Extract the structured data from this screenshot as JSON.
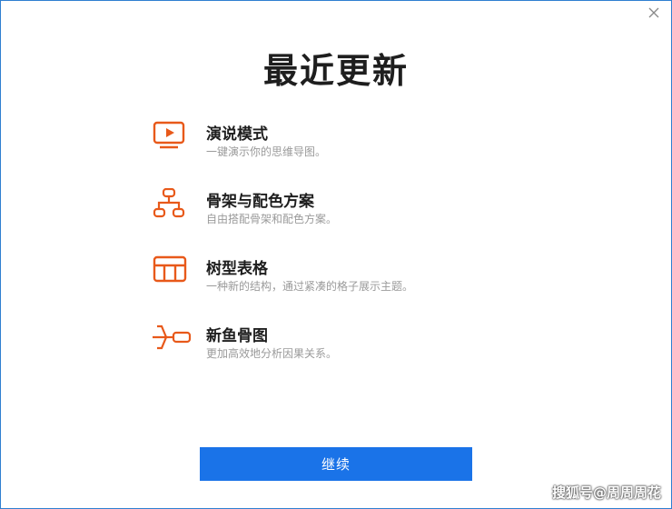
{
  "dialog": {
    "title": "最近更新",
    "close_icon": "close-icon"
  },
  "features": [
    {
      "icon": "presentation-icon",
      "title": "演说模式",
      "description": "一键演示你的思维导图。"
    },
    {
      "icon": "org-chart-icon",
      "title": "骨架与配色方案",
      "description": "自由搭配骨架和配色方案。"
    },
    {
      "icon": "table-icon",
      "title": "树型表格",
      "description": "一种新的结构，通过紧凑的格子展示主题。"
    },
    {
      "icon": "fishbone-icon",
      "title": "新鱼骨图",
      "description": "更加高效地分析因果关系。"
    }
  ],
  "continue_label": "继续",
  "watermark": "搜狐号@周周周花",
  "colors": {
    "accent": "#e8591a",
    "primary_button": "#1a73e8",
    "border": "#2f7fd0"
  }
}
